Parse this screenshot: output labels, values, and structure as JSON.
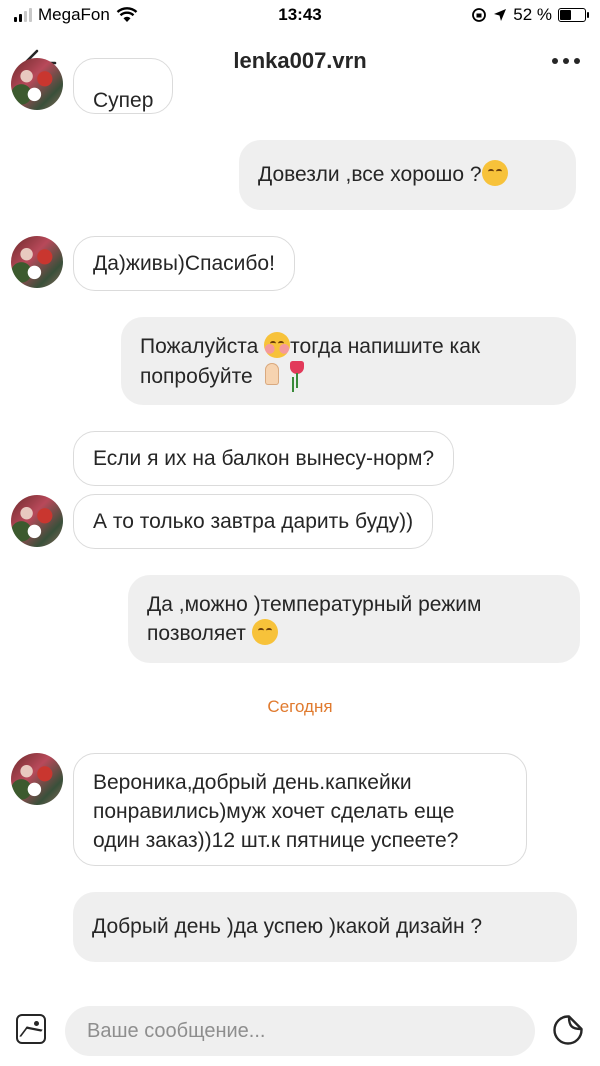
{
  "status_bar": {
    "carrier": "MegaFon",
    "time": "13:43",
    "battery": "52 %",
    "battery_level": 0.52
  },
  "header": {
    "title": "lenka007.vrn",
    "back_icon": "arrow-left-icon",
    "more_icon": "more-horizontal-icon"
  },
  "messages": [
    {
      "dir": "in",
      "text": "Супер"
    },
    {
      "dir": "out",
      "text": "Довезли ,все хорошо ?"
    },
    {
      "dir": "in",
      "text": "Да)живы)Спасибо!"
    },
    {
      "dir": "out",
      "text": "Пожалуйста",
      "text_2": "тогда напишите как попробуйте"
    },
    {
      "dir": "in",
      "text": "Если я их на балкон вынесу-норм?"
    },
    {
      "dir": "in",
      "text": "А то только завтра дарить буду))"
    },
    {
      "dir": "out",
      "text": "Да ,можно )температурный режим позволяет"
    },
    {
      "dir": "in",
      "text": "Вероника,добрый день.капкейки понравились)муж хочет сделать еще один заказ))12 шт.к пятнице успеете?"
    },
    {
      "dir": "out",
      "text": "Добрый день )да успею )какой дизайн ?"
    }
  ],
  "date_separator": "Сегодня",
  "composer": {
    "placeholder": "Ваше сообщение...",
    "gallery_icon": "gallery-icon",
    "sticker_icon": "sticker-icon"
  },
  "colors": {
    "accent_date": "#e07a2e",
    "outgoing_bubble": "#efefef",
    "incoming_border": "#dbdbdb"
  }
}
